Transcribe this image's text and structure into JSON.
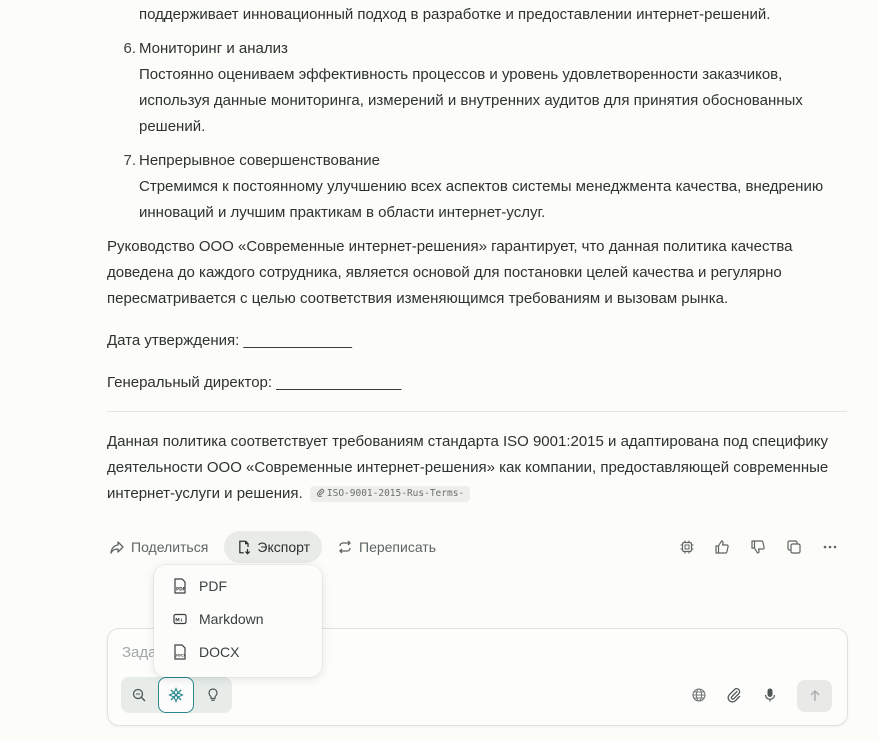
{
  "content": {
    "top_line": "поддерживает инновационный подход в разработке и предоставлении интернет-решений.",
    "items": [
      {
        "number": "6.",
        "title": "Мониторинг и анализ",
        "body": "Постоянно оцениваем эффективность процессов и уровень удовлетворенности заказчиков, используя данные мониторинга, измерений и внутренних аудитов для принятия обоснованных решений."
      },
      {
        "number": "7.",
        "title": "Непрерывное совершенствование",
        "body": "Стремимся к постоянному улучшению всех аспектов системы менеджмента качества, внедрению инноваций и лучшим практикам в области интернет-услуг."
      }
    ],
    "management_paragraph": "Руководство ООО «Современные интернет-решения» гарантирует, что данная политика качества доведена до каждого сотрудника, является основой для постановки целей качества и регулярно пересматривается с целью соответствия изменяющимся требованиям и вызовам рынка.",
    "approval_date": "Дата утверждения: _____________",
    "director": "Генеральный директор: _______________",
    "footer_paragraph": "Данная политика соответствует требованиям стандарта ISO 9001:2015 и адаптирована под специфику деятельности ООО «Современные интернет-решения» как компании, предоставляющей современные интернет-услуги и решения.",
    "source_chip": "ISO-9001-2015-Rus-Terms-"
  },
  "toolbar": {
    "share_label": "Поделиться",
    "export_label": "Экспорт",
    "rewrite_label": "Переписать"
  },
  "export_menu": {
    "items": [
      {
        "label": "PDF",
        "icon": "pdf-file-icon"
      },
      {
        "label": "Markdown",
        "icon": "markdown-icon"
      },
      {
        "label": "DOCX",
        "icon": "docx-file-icon"
      }
    ]
  },
  "composer": {
    "placeholder": "Задайте вопрос"
  },
  "colors": {
    "accent": "#2a8a90",
    "background": "#fcfcf9",
    "text": "#2c3232"
  }
}
